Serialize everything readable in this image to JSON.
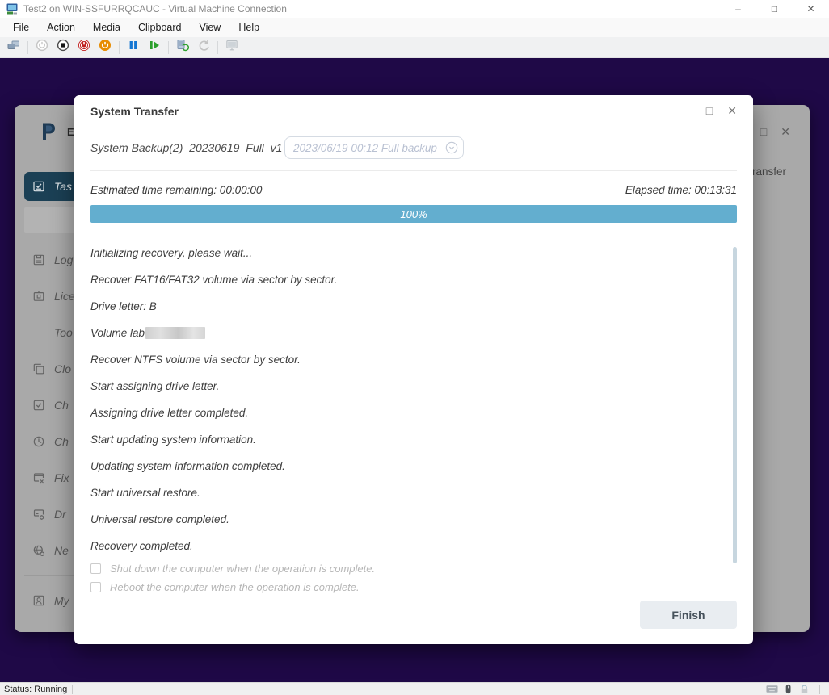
{
  "colors": {
    "desktop": "#1f0947",
    "accent_progress": "#63aecf",
    "active_sidebar": "#1b4055"
  },
  "vm_window": {
    "title": "Test2 on WIN-SSFURRQCAUC - Virtual Machine Connection",
    "window_buttons": {
      "minimize": "–",
      "maximize": "□",
      "close": "✕"
    },
    "menu": [
      {
        "label": "File",
        "name": "menu-file"
      },
      {
        "label": "Action",
        "name": "menu-action"
      },
      {
        "label": "Media",
        "name": "menu-media"
      },
      {
        "label": "Clipboard",
        "name": "menu-clipboard"
      },
      {
        "label": "View",
        "name": "menu-view"
      },
      {
        "label": "Help",
        "name": "menu-help"
      }
    ],
    "toolbar": [
      {
        "name": "ctrl-alt-del-button",
        "icon": "ctrlaltdel"
      },
      {
        "type": "sep"
      },
      {
        "name": "start-button",
        "icon": "power-gray",
        "disabled": true
      },
      {
        "name": "turn-off-button",
        "icon": "turnoff"
      },
      {
        "name": "shut-down-button",
        "icon": "shutdown"
      },
      {
        "name": "save-button",
        "icon": "save-power"
      },
      {
        "type": "sep"
      },
      {
        "name": "pause-button",
        "icon": "pause"
      },
      {
        "name": "reset-button",
        "icon": "reset"
      },
      {
        "type": "sep"
      },
      {
        "name": "checkpoint-button",
        "icon": "checkpoint"
      },
      {
        "name": "revert-button",
        "icon": "revert",
        "disabled": true
      },
      {
        "type": "sep"
      },
      {
        "name": "enhanced-session-button",
        "icon": "enhanced",
        "disabled": true
      }
    ],
    "status": {
      "text": "Status: Running"
    }
  },
  "background_window": {
    "logo_text": "Ea",
    "title_fragment": "ransfer",
    "window_buttons": {
      "maximize": "□",
      "close": "✕"
    },
    "sidebar": [
      {
        "type": "divider"
      },
      {
        "label": "Tas",
        "icon": "tasks",
        "active": true,
        "name": "sidebar-item-tasks"
      },
      {
        "type": "placeholder"
      },
      {
        "label": "Log",
        "icon": "logs",
        "name": "sidebar-item-logs"
      },
      {
        "label": "Lice",
        "icon": "license",
        "name": "sidebar-item-license"
      },
      {
        "label": "Too",
        "icon": "tools",
        "name": "sidebar-item-tools"
      },
      {
        "label": "Clo",
        "icon": "clone",
        "name": "sidebar-item-clone"
      },
      {
        "label": "Ch",
        "icon": "check-square",
        "name": "sidebar-item-check"
      },
      {
        "label": "Ch",
        "icon": "clock",
        "name": "sidebar-item-schedule"
      },
      {
        "label": "Fix",
        "icon": "fix-window",
        "name": "sidebar-item-fix"
      },
      {
        "label": "Dr",
        "icon": "drive-gear",
        "name": "sidebar-item-drive"
      },
      {
        "label": "Ne",
        "icon": "globe-gear",
        "name": "sidebar-item-network"
      },
      {
        "type": "divider"
      },
      {
        "label": "My",
        "icon": "account",
        "name": "sidebar-item-account"
      }
    ]
  },
  "dialog": {
    "title": "System Transfer",
    "backup_name": "System Backup(2)_20230619_Full_v1",
    "backup_version": "2023/06/19 00:12 Full backup",
    "estimated": "Estimated time remaining: 00:00:00",
    "elapsed": "Elapsed time: 00:13:31",
    "progress_percent": 100,
    "progress_label": "100%",
    "log_lines": [
      {
        "text": "Initializing recovery, please wait..."
      },
      {
        "text": "Recover FAT16/FAT32 volume via sector by sector."
      },
      {
        "text": "Drive letter: B"
      },
      {
        "text": "Volume lab",
        "redacted": true
      },
      {
        "text": "Recover NTFS volume via sector by sector."
      },
      {
        "text": "Start assigning drive letter."
      },
      {
        "text": "Assigning drive letter completed."
      },
      {
        "text": "Start updating system information."
      },
      {
        "text": "Updating system information completed."
      },
      {
        "text": "Start universal restore."
      },
      {
        "text": "Universal restore completed."
      },
      {
        "text": "Recovery completed."
      }
    ],
    "checkboxes": [
      {
        "label": "Shut down the computer when the operation is complete.",
        "checked": false,
        "name": "shutdown-checkbox"
      },
      {
        "label": "Reboot the computer when the operation is complete.",
        "checked": false,
        "name": "reboot-checkbox"
      }
    ],
    "finish_label": "Finish"
  }
}
